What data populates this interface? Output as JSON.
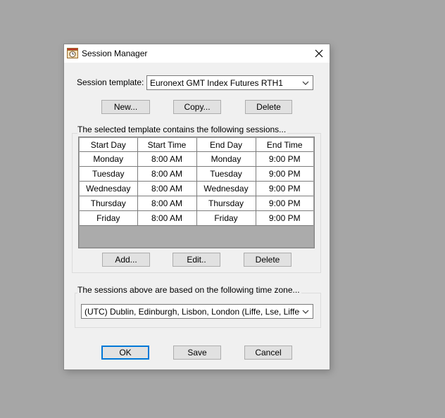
{
  "window": {
    "title": "Session Manager",
    "icon": "session-manager-app-icon",
    "close_icon": "close-icon"
  },
  "template": {
    "label": "Session template:",
    "selected": "Euronext GMT Index Futures RTH1",
    "buttons": {
      "new": "New...",
      "copy": "Copy...",
      "delete": "Delete"
    }
  },
  "sessions": {
    "group_label": "The selected template contains the following sessions...",
    "columns": [
      "Start Day",
      "Start Time",
      "End Day",
      "End Time"
    ],
    "rows": [
      [
        "Monday",
        "8:00 AM",
        "Monday",
        "9:00 PM"
      ],
      [
        "Tuesday",
        "8:00 AM",
        "Tuesday",
        "9:00 PM"
      ],
      [
        "Wednesday",
        "8:00 AM",
        "Wednesday",
        "9:00 PM"
      ],
      [
        "Thursday",
        "8:00 AM",
        "Thursday",
        "9:00 PM"
      ],
      [
        "Friday",
        "8:00 AM",
        "Friday",
        "9:00 PM"
      ]
    ],
    "buttons": {
      "add": "Add...",
      "edit": "Edit..",
      "delete": "Delete"
    }
  },
  "timezone": {
    "group_label": "The sessions above are based on the following time zone...",
    "selected": "(UTC) Dublin, Edinburgh, Lisbon, London (Liffe, Lse, LiffeCommodities)"
  },
  "footer": {
    "ok": "OK",
    "save": "Save",
    "cancel": "Cancel"
  },
  "colors": {
    "desktop": "#a6a6a6",
    "dialog_bg": "#f0f0f0",
    "focus_border": "#0078d7",
    "grid_empty": "#ababab"
  }
}
